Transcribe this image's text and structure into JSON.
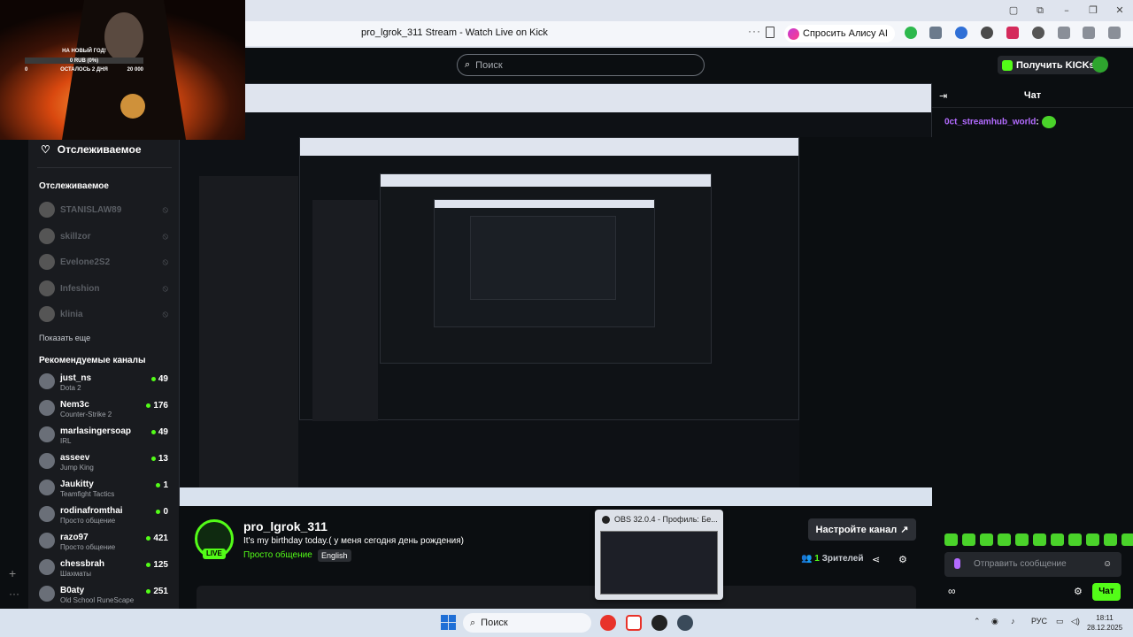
{
  "browser": {
    "tab_title": "pro_lgrok_311 Stream - Watch Live on Kick",
    "alice_label": "Спросить Алису AI",
    "menu_dots": "···"
  },
  "window_controls": {
    "minimize": "–",
    "restore": "❐",
    "close": "✕",
    "sidebar": "▢",
    "bookmark": "⧉"
  },
  "kick": {
    "search_placeholder": "Поиск",
    "get_kicks": "Получить KICKs"
  },
  "overlay": {
    "goal_title": "НА НОВЫЙ ГОД!",
    "goal_amount": "0 RUB (0%)",
    "left_value": "0",
    "days_left": "ОСТАЛОСЬ 2 ДНЯ",
    "right_value": "20 000"
  },
  "sidebar": {
    "following_title": "Отслеживаемое",
    "following_header": "Отслеживаемое",
    "following": [
      {
        "name": "STANISLAW89"
      },
      {
        "name": "skillzor"
      },
      {
        "name": "Evelone2S2"
      },
      {
        "name": "Infeshion"
      },
      {
        "name": "klinia"
      }
    ],
    "show_more": "Показать еще",
    "recommended_header": "Рекомендуемые каналы",
    "recommended": [
      {
        "name": "just_ns",
        "category": "Dota 2",
        "viewers": "49"
      },
      {
        "name": "Nem3c",
        "category": "Counter-Strike 2",
        "viewers": "176"
      },
      {
        "name": "marlasingersoap",
        "category": "IRL",
        "viewers": "49"
      },
      {
        "name": "asseev",
        "category": "Jump King",
        "viewers": "13"
      },
      {
        "name": "Jaukitty",
        "category": "Teamfight Tactics",
        "viewers": "1"
      },
      {
        "name": "rodinafromthai",
        "category": "Просто общение",
        "viewers": "0"
      },
      {
        "name": "razo97",
        "category": "Просто общение",
        "viewers": "421"
      },
      {
        "name": "chessbrah",
        "category": "Шахматы",
        "viewers": "125"
      },
      {
        "name": "B0aty",
        "category": "Old School RuneScape",
        "viewers": "251"
      }
    ]
  },
  "stream": {
    "live_badge": "LIVE",
    "name": "pro_lgrok_311",
    "title": "It's my birthday today.( у меня сегодня день рождения)",
    "category": "Просто общение",
    "language": "English",
    "settings_button": "Настройте канал",
    "viewers_count": "1",
    "viewers_label": "Зрителей"
  },
  "chat": {
    "title": "Чат",
    "message_user": "0ct_streamhub_world",
    "message_sep": ":",
    "input_placeholder": "Отправить сообщение",
    "send_label": "Чат",
    "infinity": "∞"
  },
  "obs_preview": {
    "title": "OBS 32.0.4 - Профиль: Бе..."
  },
  "taskbar": {
    "search_label": "Поиск",
    "lang": "РУС",
    "time": "18:11",
    "date": "28.12.2025"
  },
  "colors": {
    "kick_green": "#53fc18",
    "chat_purple": "#b36bff",
    "bg": "#0b0e11"
  }
}
